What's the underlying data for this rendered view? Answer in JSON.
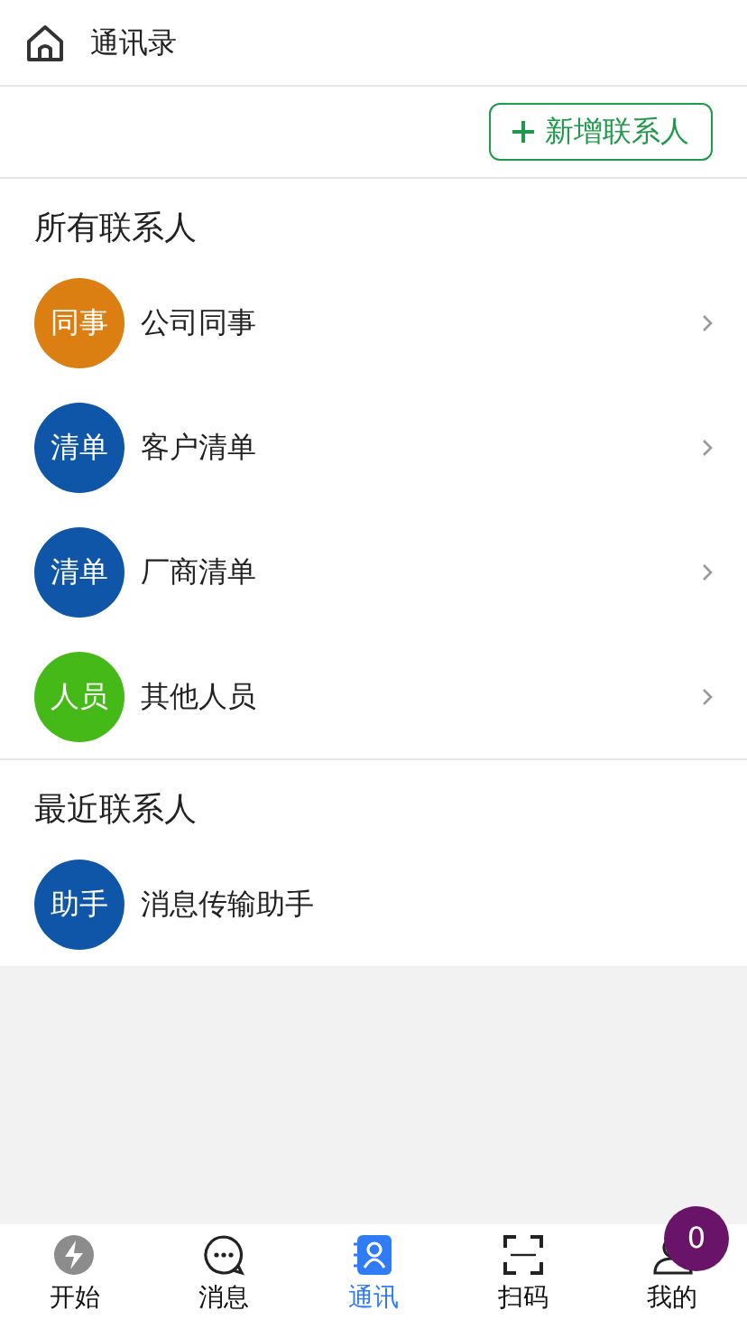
{
  "header": {
    "title": "通讯录"
  },
  "toolbar": {
    "add_button": "新增联系人"
  },
  "sections": [
    {
      "title": "所有联系人",
      "items": [
        {
          "avatar": "同事",
          "color": "#dc7f12",
          "name": "公司同事",
          "chevron": true
        },
        {
          "avatar": "清单",
          "color": "#0f56a8",
          "name": "客户清单",
          "chevron": true
        },
        {
          "avatar": "清单",
          "color": "#0f56a8",
          "name": "厂商清单",
          "chevron": true
        },
        {
          "avatar": "人员",
          "color": "#45b918",
          "name": "其他人员",
          "chevron": true
        }
      ]
    },
    {
      "title": "最近联系人",
      "items": [
        {
          "avatar": "助手",
          "color": "#0f56a8",
          "name": "消息传输助手",
          "chevron": false
        }
      ]
    }
  ],
  "tab_bar": [
    {
      "kind": "start",
      "label": "开始",
      "selected": false
    },
    {
      "kind": "messages",
      "label": "消息",
      "selected": false
    },
    {
      "kind": "contacts",
      "label": "通讯",
      "selected": true
    },
    {
      "kind": "scan",
      "label": "扫码",
      "selected": false
    },
    {
      "kind": "profile",
      "label": "我的",
      "selected": false,
      "badge": "0"
    }
  ]
}
